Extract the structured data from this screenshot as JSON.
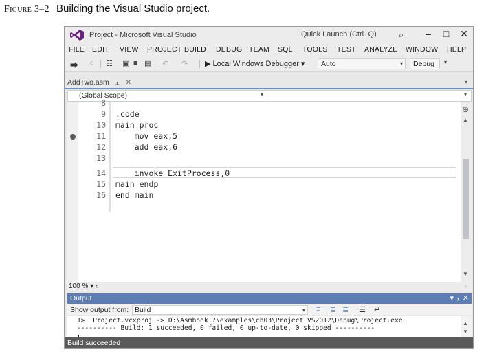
{
  "caption": {
    "figure": "Figure 3–2",
    "text": "Building the Visual Studio project."
  },
  "colors": {
    "accent_blue": "#5c7eb5",
    "status_bg": "#5a5a5a",
    "tab_line": "#6b8fc7",
    "logo_purple": "#68217a"
  },
  "window": {
    "title": "Project - Microsoft Visual Studio",
    "quick_launch": "Quick Launch (Ctrl+Q)",
    "icons": [
      "visual-studio-logo",
      "search-icon",
      "minimize-icon",
      "maximize-icon",
      "close-icon"
    ]
  },
  "menu": [
    "FILE",
    "EDIT",
    "VIEW",
    "PROJECT",
    "BUILD",
    "DEBUG",
    "TEAM",
    "SQL",
    "TOOLS",
    "TEST",
    "ANALYZE",
    "WINDOW",
    "HELP"
  ],
  "toolbar": {
    "debugger": "Local Windows Debugger",
    "platform": "Auto",
    "configuration": "Debug"
  },
  "doc_tab": {
    "name": "AddTwo.asm"
  },
  "scope": "(Global Scope)",
  "code": {
    "line_numbers": [
      "8",
      "9",
      "10",
      "11",
      "12",
      "13",
      "14",
      "15",
      "16"
    ],
    "lines": [
      "",
      ".code",
      "main proc",
      "    mov eax,5",
      "    add eax,6",
      "",
      "    invoke ExitProcess,0",
      "main endp",
      "end main"
    ],
    "breakpoint_line": "11",
    "current_line": "14"
  },
  "zoom": "100 %",
  "output": {
    "title": "Output",
    "show_from_label": "Show output from:",
    "source": "Build",
    "lines": [
      "1>  Project.vcxproj -> D:\\Asmbook 7\\examples\\ch03\\Project_VS2012\\Debug\\Project.exe",
      "---------- Build: 1 succeeded, 0 failed, 0 up-to-date, 0 skipped ----------"
    ]
  },
  "status": "Build succeeded"
}
